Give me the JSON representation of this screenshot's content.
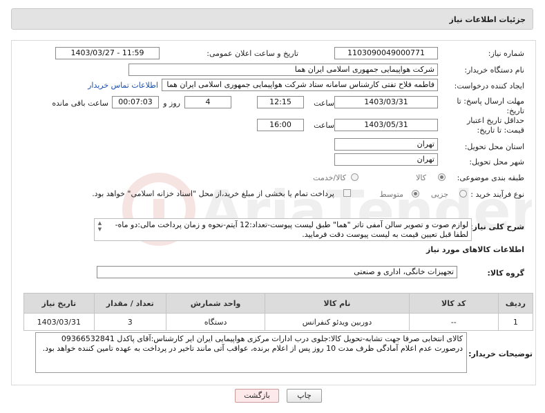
{
  "header": {
    "title": "جزئیات اطلاعات نیاز"
  },
  "form": {
    "need_number": {
      "label": "شماره نیاز:",
      "value": "1103090049000771"
    },
    "announce_date": {
      "label": "تاریخ و ساعت اعلان عمومی:",
      "value": "1403/03/27 - 11:59"
    },
    "buyer_org": {
      "label": "نام دستگاه خریدار:",
      "value": "شرکت هواپیمایی جمهوری اسلامی ایران هما"
    },
    "requester": {
      "label": "ایجاد کننده درخواست:",
      "value": "فاطمه فلاح تفتی کارشناس سامانه ستاد شرکت هواپیمایی جمهوری اسلامی ایران هما",
      "contact_link": "اطلاعات تماس خریدار"
    },
    "deadline": {
      "label": "مهلت ارسال پاسخ: تا تاریخ:",
      "date": "1403/03/31",
      "time_label": "ساعت",
      "time": "12:15",
      "days": "4",
      "days_label": "روز و",
      "remaining": "00:07:03",
      "remaining_label": "ساعت باقی مانده"
    },
    "validity": {
      "label": "حداقل تاریخ اعتبار قیمت: تا تاریخ:",
      "date": "1403/05/31",
      "time_label": "ساعت",
      "time": "16:00"
    },
    "province": {
      "label": "استان محل تحویل:",
      "value": "تهران"
    },
    "city": {
      "label": "شهر محل تحویل:",
      "value": "تهران"
    },
    "category": {
      "label": "طبقه بندی موضوعی:",
      "options": [
        "کالا",
        "کالا/خدمت"
      ],
      "selected": "کالا"
    },
    "process": {
      "label": "نوع فرآیند خرید :",
      "options": [
        "جزیی",
        "متوسط"
      ],
      "selected": "متوسط",
      "note": "پرداخت تمام یا بخشی از مبلغ خرید،از محل \"اسناد خزانه اسلامی\" خواهد بود."
    },
    "general_desc": {
      "label": "شرح کلی نیاز:",
      "value": "لوازم صوت و تصویر سالن آمفی تاتر \"هما\" طبق لیست پیوست-تعداد:12 آیتم-نحوه و زمان پرداخت مالی:دو ماه-لطفا قبل تعیین قیمت به لیست پیوست دقت فرمایید."
    }
  },
  "goods": {
    "section_title": "اطلاعات کالاهای مورد نیاز",
    "group_label": "گروه کالا:",
    "group_value": "تجهیزات خانگی، اداری و صنعتی",
    "columns": [
      "ردیف",
      "کد کالا",
      "نام کالا",
      "واحد شمارش",
      "تعداد / مقدار",
      "تاریخ نیاز"
    ],
    "rows": [
      {
        "row": "1",
        "code": "--",
        "name": "دوربین ویدئو کنفرانس",
        "unit": "دستگاه",
        "qty": "3",
        "date": "1403/03/31"
      }
    ]
  },
  "buyer_notes": {
    "label": "توضیحات خریدار:",
    "value": "کالای انتخابی صرفا جهت تشابه-تحویل کالا:جلوی درب ادارات مرکزی هواپیمایی ایران ایر کارشناس:آقای پاکدل 09366532841 درصورت عدم اعلام آمادگی ظرف مدت 10 روز پس از اعلام برنده، عواقب آتی مانند تاخیر در پرداخت به عهده تامین کننده خواهد بود."
  },
  "buttons": {
    "print": "چاپ",
    "back": "بازگشت"
  },
  "colors": {
    "header_bg": "#e3e3e3",
    "link": "#1a4fb0",
    "table_header": "#dcdcdc",
    "back_button": "#fde9ea"
  }
}
